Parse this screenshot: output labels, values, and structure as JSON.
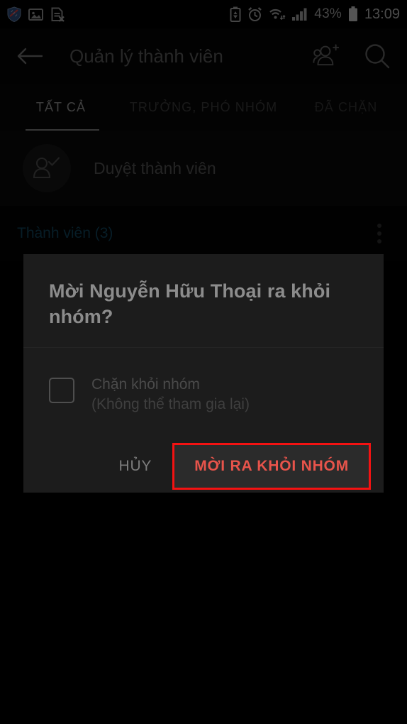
{
  "status_bar": {
    "icons_left": [
      "shield-icon",
      "image-icon",
      "sim-card-off-icon"
    ],
    "icons_right": [
      "battery-saver-icon",
      "alarm-clock-icon",
      "wifi-icon",
      "signal-bars-icon"
    ],
    "battery_percent": "43%",
    "clock": "13:09"
  },
  "app_bar": {
    "back_icon": "back-arrow-icon",
    "title": "Quản lý thành viên",
    "add_members_icon": "add-members-icon",
    "search_icon": "search-icon"
  },
  "tabs": [
    {
      "label": "TẤT CẢ",
      "active": true
    },
    {
      "label": "TRƯỞNG, PHÓ NHÓM",
      "active": false
    },
    {
      "label": "ĐÃ CHẶN",
      "active": false
    }
  ],
  "approve_row": {
    "icon": "person-check-icon",
    "label": "Duyệt thành viên"
  },
  "members_header": {
    "label": "Thành viên (3)",
    "color": "#114058",
    "overflow_icon": "more-vertical-icon"
  },
  "dialog": {
    "title": "Mời Nguyễn Hữu Thoại ra khỏi nhóm?",
    "checkbox": {
      "checked": false,
      "label_line1": "Chặn khỏi nhóm",
      "label_line2": "(Không thể tham gia lại)"
    },
    "cancel_label": "HỦY",
    "confirm_label": "MỜI RA KHỎI NHÓM",
    "confirm_color": "#e8544b",
    "highlight_color": "#f41212"
  }
}
